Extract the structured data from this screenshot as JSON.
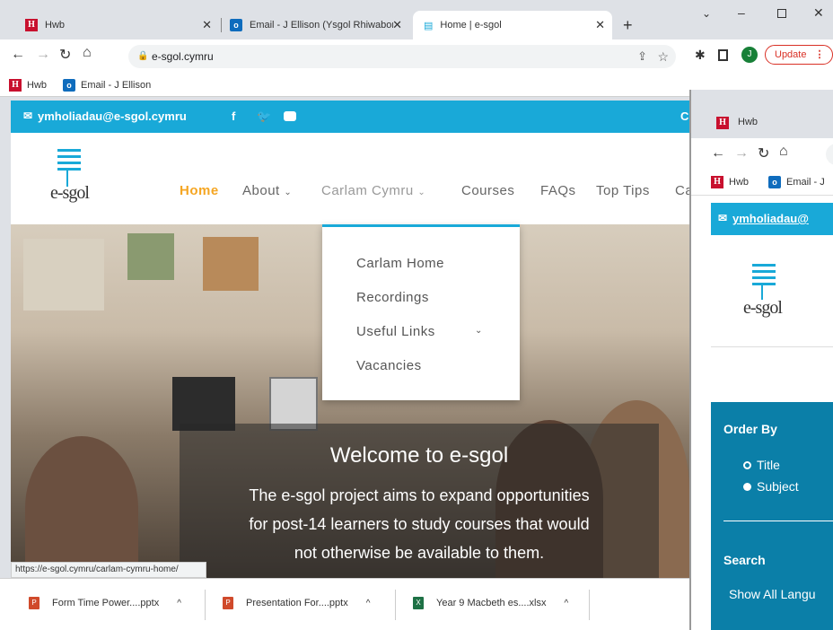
{
  "browser": {
    "tabs": [
      {
        "title": "Hwb",
        "icon": "hwb-icon"
      },
      {
        "title": "Email - J Ellison (Ysgol Rhiwabon)",
        "icon": "outlook-icon"
      },
      {
        "title": "Home | e-sgol",
        "icon": "page-icon"
      }
    ],
    "address": "e-sgol.cymru",
    "update_label": "Update",
    "profile_initial": "J",
    "bookmarks": [
      {
        "label": "Hwb"
      },
      {
        "label": "Email - J Ellison"
      }
    ]
  },
  "site": {
    "email": "ymholiadau@e-sgol.cymru",
    "topbar_right": "C",
    "logo_text": "e-sgol",
    "nav": [
      {
        "label": "Home"
      },
      {
        "label": "About"
      },
      {
        "label": "Carlam Cymru"
      },
      {
        "label": "Courses"
      },
      {
        "label": "FAQs"
      },
      {
        "label": "Top Tips"
      },
      {
        "label": "Ca"
      }
    ],
    "dropdown": [
      {
        "label": "Carlam Home"
      },
      {
        "label": "Recordings"
      },
      {
        "label": "Useful Links"
      },
      {
        "label": "Vacancies"
      }
    ],
    "hero_title": "Welcome to e-sgol",
    "hero_line1": "The e-sgol project aims to expand opportunities",
    "hero_line2": "for post-14 learners to study courses that would",
    "hero_line3": "not otherwise be available to them."
  },
  "status_url": "https://e-sgol.cymru/carlam-cymru-home/",
  "downloads": [
    {
      "name": "Form Time Power....pptx"
    },
    {
      "name": "Presentation For....pptx"
    },
    {
      "name": "Year 9 Macbeth es....xlsx"
    }
  ],
  "window2": {
    "bookmark_hwb": "Hwb",
    "bookmark_email": "Email - J",
    "tab_hwb": "Hwb",
    "email": "ymholiadau@",
    "logo_text": "e-sgol",
    "order_by": "Order By",
    "options": [
      {
        "label": "Title"
      },
      {
        "label": "Subject"
      }
    ],
    "search": "Search",
    "show_all": "Show All Langu"
  },
  "colors": {
    "accent": "#19a9d8",
    "nav_active": "#f5a623",
    "sidebar": "#0b7fa8"
  }
}
